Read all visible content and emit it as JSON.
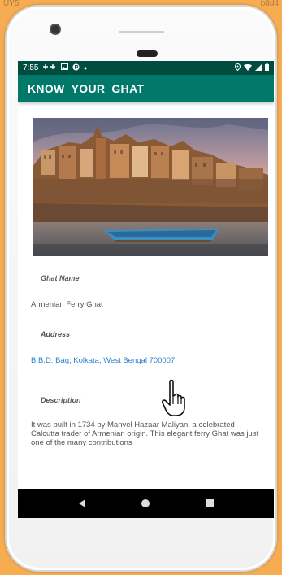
{
  "corner": {
    "left": "UY5",
    "right": "b8d4"
  },
  "statusbar": {
    "time": "7:55"
  },
  "appbar": {
    "title": "KNOW_YOUR_GHAT"
  },
  "details": {
    "ghat_name_label": "Ghat Name",
    "ghat_name_value": "Armenian Ferry Ghat",
    "address_label": "Address",
    "address_value": "B.B.D. Bag, Kolkata, West Bengal 700007",
    "description_label": "Description",
    "description_value": "It was built in 1734 by Manvel Hazaar Maliyan, a celebrated Calcutta trader of Armenian origin. This elegant ferry Ghat was just one of the many contributions"
  },
  "colors": {
    "statusbar": "#004d40",
    "appbar": "#00796b",
    "link": "#2e7fcf",
    "background": "#f6ad52"
  },
  "icons": [
    "camera-icon",
    "android-debug-icon",
    "image-icon",
    "location-icon",
    "wifi-icon",
    "signal-icon",
    "battery-icon",
    "back-icon",
    "home-icon",
    "recents-icon",
    "hand-cursor-icon"
  ]
}
